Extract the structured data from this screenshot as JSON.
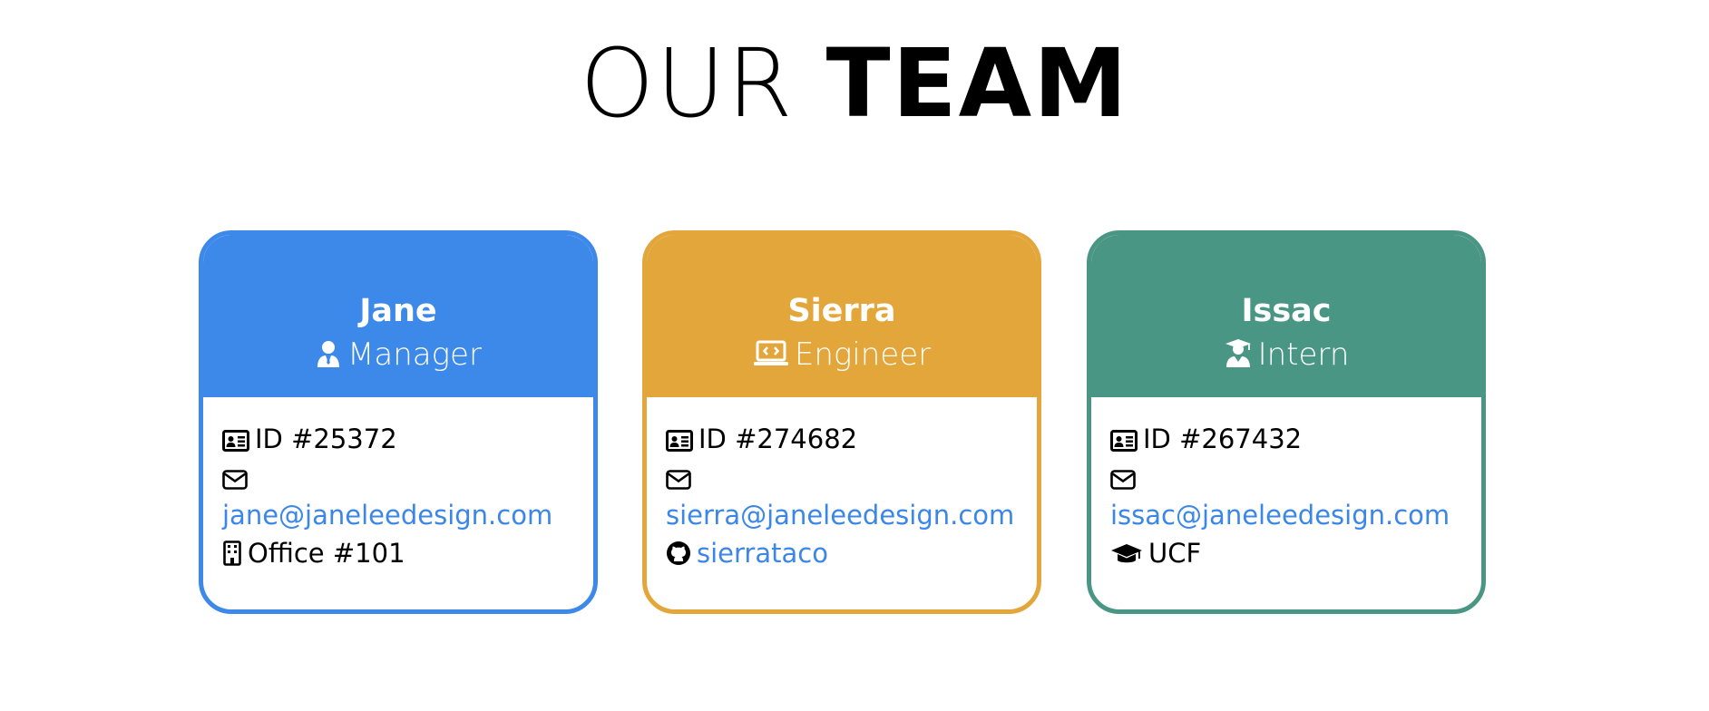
{
  "header": {
    "title_light": "OUR",
    "title_bold": "TEAM"
  },
  "colors": {
    "manager": "#3c89ea",
    "engineer": "#e3a63a",
    "intern": "#4a9684",
    "link": "#3b87e8"
  },
  "cards": [
    {
      "name": "Jane",
      "role": "Manager",
      "role_icon": "user-tie-icon",
      "id_text": "ID #25372",
      "email": "jane@janeleedesign.com",
      "extra_icon": "building-icon",
      "extra_text": "Office #101"
    },
    {
      "name": "Sierra",
      "role": "Engineer",
      "role_icon": "laptop-code-icon",
      "id_text": "ID #274682",
      "email": "sierra@janeleedesign.com",
      "extra_icon": "github-icon",
      "extra_text": "sierrataco"
    },
    {
      "name": "Issac",
      "role": "Intern",
      "role_icon": "user-graduate-icon",
      "id_text": "ID #267432",
      "email": "issac@janeleedesign.com",
      "extra_icon": "graduation-cap-icon",
      "extra_text": "UCF"
    }
  ]
}
